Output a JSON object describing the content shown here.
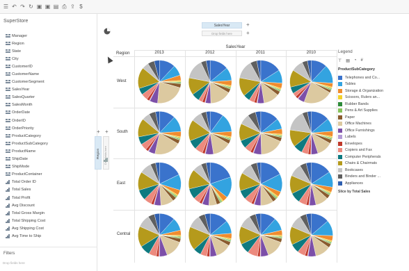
{
  "toolbar": {
    "icons": [
      "menu-icon",
      "undo-icon",
      "redo-icon",
      "refresh-icon",
      "save-icon",
      "save-as-icon",
      "export-icon",
      "print-icon",
      "share-icon",
      "dollar-icon"
    ],
    "glyphs": [
      "☰",
      "↶",
      "↷",
      "↻",
      "▣",
      "▣",
      "▤",
      "⎙",
      "⇪",
      "$"
    ]
  },
  "left_panel": {
    "title": "SuperStore",
    "fields": [
      {
        "label": "Manager",
        "kind": "dim"
      },
      {
        "label": "Region",
        "kind": "dim"
      },
      {
        "label": "State",
        "kind": "dim"
      },
      {
        "label": "City",
        "kind": "dim"
      },
      {
        "label": "CustomerID",
        "kind": "dim"
      },
      {
        "label": "CustomerName",
        "kind": "dim"
      },
      {
        "label": "CustomerSegment",
        "kind": "dim"
      },
      {
        "label": "SalesYear",
        "kind": "dim"
      },
      {
        "label": "SalesQuarter",
        "kind": "dim"
      },
      {
        "label": "SalesMonth",
        "kind": "dim"
      },
      {
        "label": "OrderDate",
        "kind": "dim"
      },
      {
        "label": "OrderID",
        "kind": "dim"
      },
      {
        "label": "OrderPriority",
        "kind": "dim"
      },
      {
        "label": "ProductCategory",
        "kind": "dim"
      },
      {
        "label": "ProductSubCategory",
        "kind": "dim"
      },
      {
        "label": "ProductName",
        "kind": "dim"
      },
      {
        "label": "ShipDate",
        "kind": "dim"
      },
      {
        "label": "ShipMode",
        "kind": "dim"
      },
      {
        "label": "ProductContainer",
        "kind": "dim"
      },
      {
        "label": "Total Order ID",
        "kind": "mea"
      },
      {
        "label": "Total Sales",
        "kind": "mea"
      },
      {
        "label": "Total Profit",
        "kind": "mea"
      },
      {
        "label": "Avg Discount",
        "kind": "mea"
      },
      {
        "label": "Total Gross Margin",
        "kind": "mea"
      },
      {
        "label": "Total Shipping Cost",
        "kind": "mea"
      },
      {
        "label": "Avg Shipping Cost",
        "kind": "mea"
      },
      {
        "label": "Avg Time to Ship",
        "kind": "mea"
      }
    ],
    "filters_title": "Filters",
    "filters_hint": "Drop fields here"
  },
  "shelves": {
    "columns_pill": "SalesYear",
    "columns_drop": "Drop  fields here",
    "rows_pill": "Region",
    "rows_drop": "Drop fields here",
    "plus": "+"
  },
  "table": {
    "row_header": "Region",
    "col_header": "SalesYear",
    "years": [
      "2013",
      "2012",
      "2011",
      "2010"
    ],
    "regions": [
      "West",
      "South",
      "East",
      "Central"
    ]
  },
  "legend": {
    "title": "Legend",
    "tools": [
      "⊤",
      "▤",
      "◔",
      "#"
    ],
    "field": "ProductSubCategory",
    "items": [
      {
        "label": "Telephones and Co...",
        "color": "#3a73cc"
      },
      {
        "label": "Tables",
        "color": "#33a3e0"
      },
      {
        "label": "Storage & Organization",
        "color": "#f08c2e"
      },
      {
        "label": "Scissors, Rulers an...",
        "color": "#f2d12b"
      },
      {
        "label": "Rubber Bands",
        "color": "#2e8b3a"
      },
      {
        "label": "Pens & Art Supplies",
        "color": "#86c25a"
      },
      {
        "label": "Paper",
        "color": "#8a5c2e"
      },
      {
        "label": "Office Machines",
        "color": "#dcc9a0"
      },
      {
        "label": "Office Furnishings",
        "color": "#7c4fa8"
      },
      {
        "label": "Labels",
        "color": "#b39ad6"
      },
      {
        "label": "Envelopes",
        "color": "#c0392b"
      },
      {
        "label": "Copiers and Fax",
        "color": "#ec8a7e"
      },
      {
        "label": "Computer Peripherals",
        "color": "#0e7a80"
      },
      {
        "label": "Chairs & Chairmats",
        "color": "#b59a1c"
      },
      {
        "label": "Bookcases",
        "color": "#c4c4c4"
      },
      {
        "label": "Binders and Binder ...",
        "color": "#5f5f5f"
      },
      {
        "label": "Appliances",
        "color": "#2f5fb0"
      }
    ],
    "footer": "Slice by Total Sales"
  },
  "chart_data": {
    "type": "pie",
    "title": "",
    "rows_field": "Region",
    "cols_field": "SalesYear",
    "slice_field": "ProductSubCategory",
    "measure": "Total Sales",
    "categories": [
      "Telephones and Co...",
      "Tables",
      "Storage & Organization",
      "Scissors, Rulers an...",
      "Rubber Bands",
      "Pens & Art Supplies",
      "Paper",
      "Office Machines",
      "Office Furnishings",
      "Labels",
      "Envelopes",
      "Copiers and Fax",
      "Computer Peripherals",
      "Chairs & Chairmats",
      "Bookcases",
      "Binders and Binder ...",
      "Appliances"
    ],
    "pies": [
      {
        "region": "West",
        "year": "2013",
        "values": [
          12,
          8,
          4,
          1,
          0.5,
          1,
          3,
          22,
          6,
          0.5,
          2,
          5,
          5,
          16,
          5,
          5,
          4
        ]
      },
      {
        "region": "West",
        "year": "2012",
        "values": [
          14,
          10,
          4,
          1,
          0.5,
          1,
          3,
          16,
          4,
          0.5,
          2,
          3,
          6,
          13,
          15,
          4,
          3
        ]
      },
      {
        "region": "West",
        "year": "2011",
        "values": [
          16,
          10,
          4,
          1,
          0.5,
          1,
          3,
          12,
          5,
          0.5,
          2,
          4,
          5,
          14,
          14,
          5,
          3
        ]
      },
      {
        "region": "West",
        "year": "2010",
        "values": [
          12,
          14,
          3,
          1,
          0.5,
          1,
          2,
          22,
          5,
          0.5,
          2,
          3,
          5,
          13,
          9,
          4,
          3
        ]
      },
      {
        "region": "South",
        "year": "2013",
        "values": [
          12,
          12,
          4,
          1,
          0.5,
          1,
          3,
          20,
          5,
          0.5,
          2,
          5,
          6,
          14,
          6,
          5,
          3
        ]
      },
      {
        "region": "South",
        "year": "2012",
        "values": [
          10,
          14,
          4,
          1,
          0.5,
          1,
          3,
          14,
          6,
          0.5,
          2,
          6,
          7,
          16,
          8,
          4,
          3
        ]
      },
      {
        "region": "South",
        "year": "2011",
        "values": [
          14,
          8,
          4,
          1,
          0.5,
          1,
          3,
          18,
          6,
          0.5,
          2,
          5,
          6,
          13,
          8,
          6,
          4
        ]
      },
      {
        "region": "South",
        "year": "2010",
        "values": [
          14,
          10,
          4,
          1,
          0.5,
          1,
          3,
          12,
          5,
          0.5,
          2,
          5,
          7,
          13,
          16,
          4,
          3
        ]
      },
      {
        "region": "East",
        "year": "2013",
        "values": [
          18,
          12,
          4,
          1,
          0.5,
          1,
          3,
          10,
          5,
          0.5,
          2,
          6,
          8,
          14,
          9,
          4,
          3
        ]
      },
      {
        "region": "East",
        "year": "2012",
        "values": [
          20,
          16,
          4,
          1,
          0.5,
          1,
          3,
          6,
          5,
          0.5,
          2,
          5,
          8,
          15,
          7,
          4,
          3
        ]
      },
      {
        "region": "East",
        "year": "2011",
        "values": [
          18,
          14,
          4,
          1,
          0.5,
          1,
          3,
          10,
          5,
          0.5,
          2,
          6,
          7,
          14,
          9,
          5,
          3
        ]
      },
      {
        "region": "East",
        "year": "2010",
        "values": [
          16,
          12,
          4,
          1,
          0.5,
          1,
          3,
          10,
          5,
          0.5,
          2,
          6,
          8,
          14,
          10,
          5,
          4
        ]
      },
      {
        "region": "Central",
        "year": "2013",
        "values": [
          12,
          10,
          4,
          1,
          0.5,
          1,
          3,
          14,
          6,
          0.5,
          2,
          6,
          8,
          16,
          10,
          5,
          4
        ]
      },
      {
        "region": "Central",
        "year": "2012",
        "values": [
          14,
          10,
          4,
          1,
          0.5,
          1,
          3,
          12,
          5,
          0.5,
          2,
          5,
          6,
          18,
          10,
          5,
          4
        ]
      },
      {
        "region": "Central",
        "year": "2011",
        "values": [
          12,
          10,
          4,
          1,
          0.5,
          1,
          3,
          14,
          6,
          0.5,
          2,
          8,
          8,
          14,
          10,
          5,
          4
        ]
      },
      {
        "region": "Central",
        "year": "2010",
        "values": [
          14,
          12,
          4,
          1,
          0.5,
          1,
          3,
          12,
          6,
          0.5,
          2,
          6,
          7,
          14,
          10,
          5,
          4
        ]
      }
    ]
  }
}
